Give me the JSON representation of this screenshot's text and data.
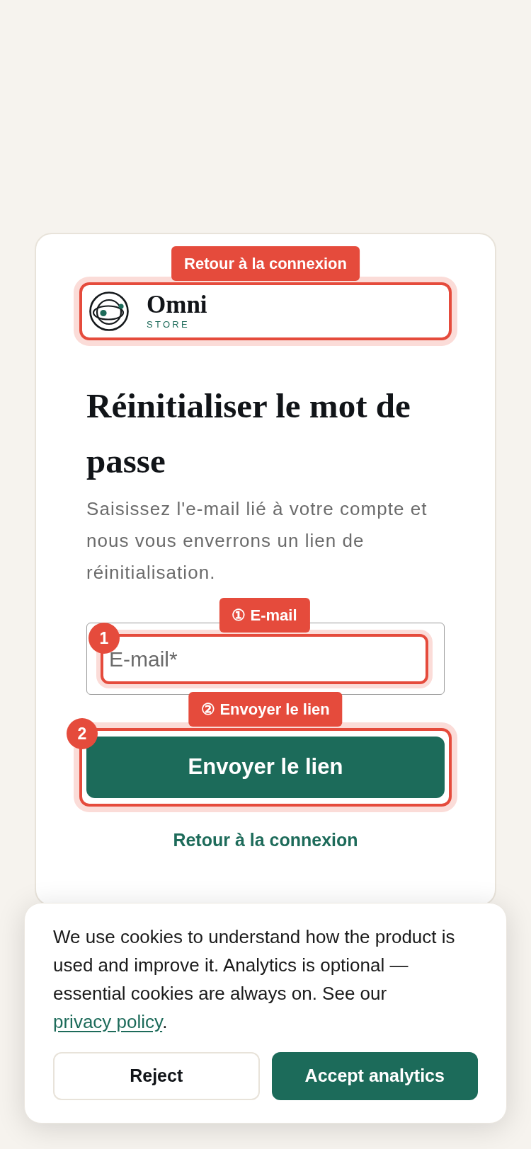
{
  "card": {
    "logo": {
      "name": "Omni",
      "tagline": "STORE",
      "annotation": {
        "label": "Retour à la connexion"
      }
    },
    "title": "Réinitialiser le mot de passe",
    "description": "Saisissez l'e-mail lié à votre compte et nous vous enverrons un lien de réinitialisation.",
    "email_field": {
      "placeholder": "E-mail*",
      "annotation": {
        "label": "① E-mail",
        "badge": "1"
      }
    },
    "submit_button": {
      "label": "Envoyer le lien",
      "annotation": {
        "label": "② Envoyer le lien",
        "badge": "2"
      }
    },
    "back_link": "Retour à la connexion"
  },
  "cookie_banner": {
    "text": "We use cookies to understand how the product is used and improve it. Analytics is optional — essential cookies are always on. See our",
    "link": "privacy policy",
    "text_after": ".",
    "buttons": [
      {
        "label": "Reject",
        "kind": "secondary"
      },
      {
        "label": "Accept analytics",
        "kind": "primary"
      }
    ]
  }
}
